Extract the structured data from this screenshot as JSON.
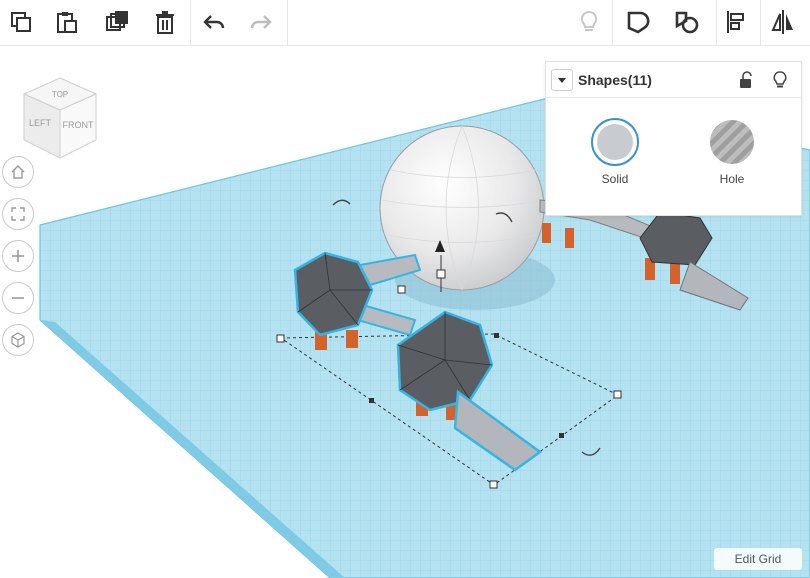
{
  "toolbar": {
    "left_tools": [
      "copy-icon",
      "paste-icon",
      "duplicate-icon",
      "delete-icon",
      "undo-icon",
      "redo-icon"
    ],
    "right_tools": [
      "light-bulb-icon",
      "shape-group-icon",
      "shape-ungroup-icon",
      "align-icon",
      "mirror-icon"
    ]
  },
  "viewcube": {
    "top": "TOP",
    "left": "LEFT",
    "front": "FRONT"
  },
  "nav": [
    "home-view-icon",
    "fit-view-icon",
    "zoom-in-icon",
    "zoom-out-icon",
    "perspective-icon"
  ],
  "panel": {
    "title": "Shapes(11)",
    "solid_label": "Solid",
    "hole_label": "Hole",
    "solid_color": "#c8cbd0",
    "accent": "#3b8fd6"
  },
  "workplane": {
    "grid_color": "#a9dcef",
    "grid_line_color": "#6fc3e3",
    "selection_outline": "#36b5e5",
    "leg_color": "#d4622a"
  },
  "edit_grid_label": "Edit Grid"
}
